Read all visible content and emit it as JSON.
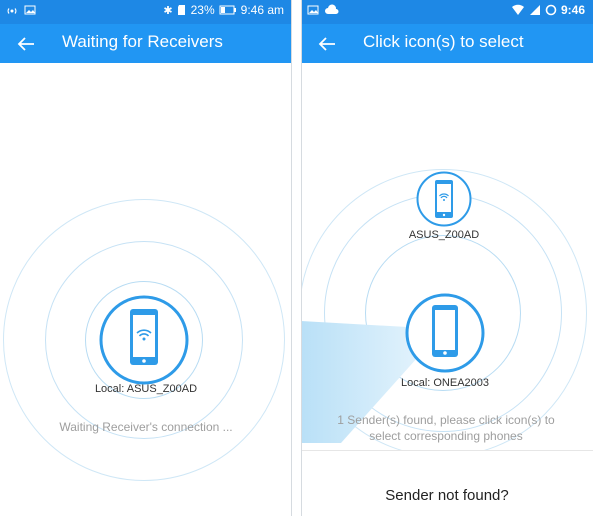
{
  "left": {
    "status": {
      "battery": "23%",
      "time": "9:46 am"
    },
    "title": "Waiting for Receivers",
    "device_label": "Local: ASUS_Z00AD",
    "hint": "Waiting Receiver's connection ..."
  },
  "right": {
    "status": {
      "time": "9:46"
    },
    "title": "Click icon(s) to select",
    "found_device_label": "ASUS_Z00AD",
    "local_device_label": "Local: ONEA2003",
    "hint_line1": "1 Sender(s) found, please click icon(s) to",
    "hint_line2": "select corresponding phones",
    "bottom_link": "Sender not found?"
  },
  "colors": {
    "appbar": "#2196f3",
    "statusbar": "#1e88e5",
    "accent": "#2e9be8"
  }
}
